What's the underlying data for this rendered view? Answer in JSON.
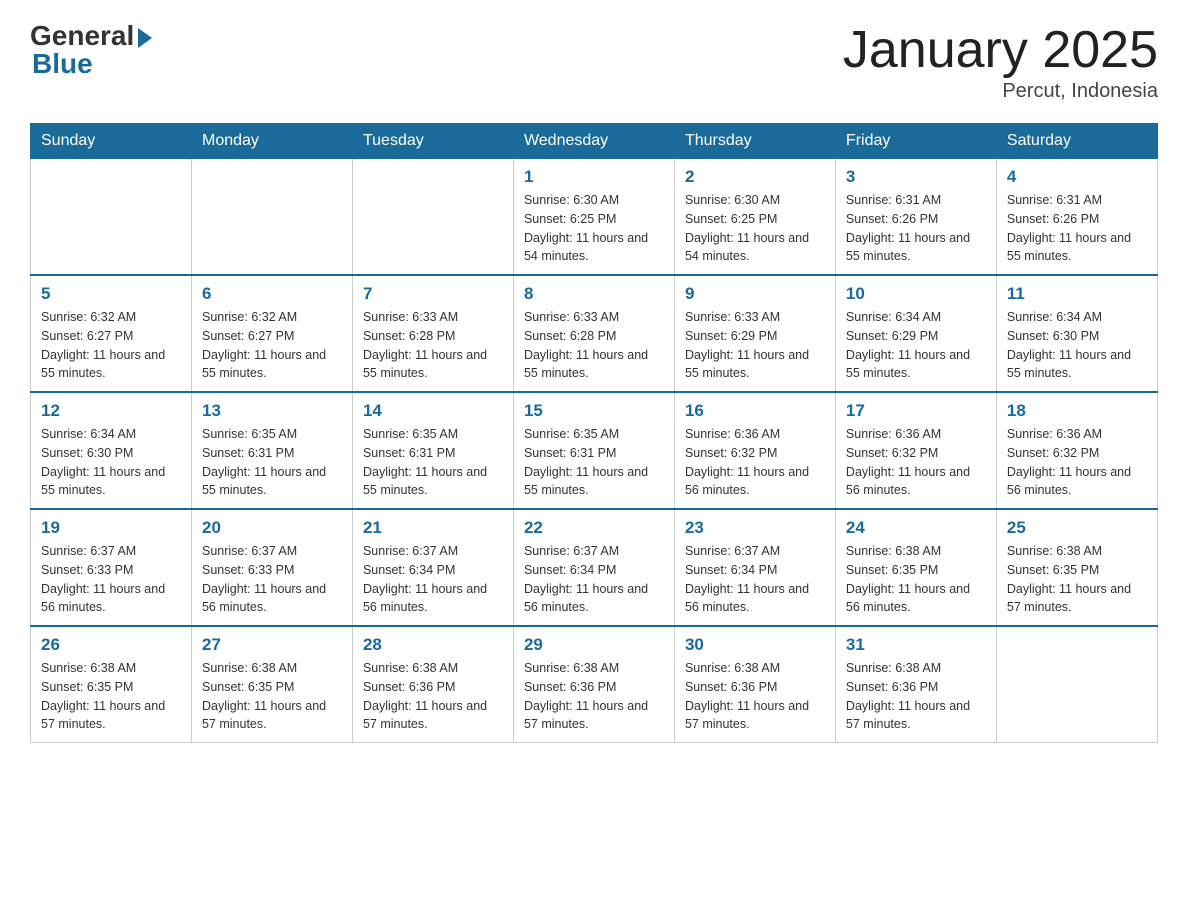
{
  "logo": {
    "general": "General",
    "blue": "Blue"
  },
  "title": "January 2025",
  "subtitle": "Percut, Indonesia",
  "days_of_week": [
    "Sunday",
    "Monday",
    "Tuesday",
    "Wednesday",
    "Thursday",
    "Friday",
    "Saturday"
  ],
  "weeks": [
    [
      {
        "day": "",
        "info": ""
      },
      {
        "day": "",
        "info": ""
      },
      {
        "day": "",
        "info": ""
      },
      {
        "day": "1",
        "info": "Sunrise: 6:30 AM\nSunset: 6:25 PM\nDaylight: 11 hours and 54 minutes."
      },
      {
        "day": "2",
        "info": "Sunrise: 6:30 AM\nSunset: 6:25 PM\nDaylight: 11 hours and 54 minutes."
      },
      {
        "day": "3",
        "info": "Sunrise: 6:31 AM\nSunset: 6:26 PM\nDaylight: 11 hours and 55 minutes."
      },
      {
        "day": "4",
        "info": "Sunrise: 6:31 AM\nSunset: 6:26 PM\nDaylight: 11 hours and 55 minutes."
      }
    ],
    [
      {
        "day": "5",
        "info": "Sunrise: 6:32 AM\nSunset: 6:27 PM\nDaylight: 11 hours and 55 minutes."
      },
      {
        "day": "6",
        "info": "Sunrise: 6:32 AM\nSunset: 6:27 PM\nDaylight: 11 hours and 55 minutes."
      },
      {
        "day": "7",
        "info": "Sunrise: 6:33 AM\nSunset: 6:28 PM\nDaylight: 11 hours and 55 minutes."
      },
      {
        "day": "8",
        "info": "Sunrise: 6:33 AM\nSunset: 6:28 PM\nDaylight: 11 hours and 55 minutes."
      },
      {
        "day": "9",
        "info": "Sunrise: 6:33 AM\nSunset: 6:29 PM\nDaylight: 11 hours and 55 minutes."
      },
      {
        "day": "10",
        "info": "Sunrise: 6:34 AM\nSunset: 6:29 PM\nDaylight: 11 hours and 55 minutes."
      },
      {
        "day": "11",
        "info": "Sunrise: 6:34 AM\nSunset: 6:30 PM\nDaylight: 11 hours and 55 minutes."
      }
    ],
    [
      {
        "day": "12",
        "info": "Sunrise: 6:34 AM\nSunset: 6:30 PM\nDaylight: 11 hours and 55 minutes."
      },
      {
        "day": "13",
        "info": "Sunrise: 6:35 AM\nSunset: 6:31 PM\nDaylight: 11 hours and 55 minutes."
      },
      {
        "day": "14",
        "info": "Sunrise: 6:35 AM\nSunset: 6:31 PM\nDaylight: 11 hours and 55 minutes."
      },
      {
        "day": "15",
        "info": "Sunrise: 6:35 AM\nSunset: 6:31 PM\nDaylight: 11 hours and 55 minutes."
      },
      {
        "day": "16",
        "info": "Sunrise: 6:36 AM\nSunset: 6:32 PM\nDaylight: 11 hours and 56 minutes."
      },
      {
        "day": "17",
        "info": "Sunrise: 6:36 AM\nSunset: 6:32 PM\nDaylight: 11 hours and 56 minutes."
      },
      {
        "day": "18",
        "info": "Sunrise: 6:36 AM\nSunset: 6:32 PM\nDaylight: 11 hours and 56 minutes."
      }
    ],
    [
      {
        "day": "19",
        "info": "Sunrise: 6:37 AM\nSunset: 6:33 PM\nDaylight: 11 hours and 56 minutes."
      },
      {
        "day": "20",
        "info": "Sunrise: 6:37 AM\nSunset: 6:33 PM\nDaylight: 11 hours and 56 minutes."
      },
      {
        "day": "21",
        "info": "Sunrise: 6:37 AM\nSunset: 6:34 PM\nDaylight: 11 hours and 56 minutes."
      },
      {
        "day": "22",
        "info": "Sunrise: 6:37 AM\nSunset: 6:34 PM\nDaylight: 11 hours and 56 minutes."
      },
      {
        "day": "23",
        "info": "Sunrise: 6:37 AM\nSunset: 6:34 PM\nDaylight: 11 hours and 56 minutes."
      },
      {
        "day": "24",
        "info": "Sunrise: 6:38 AM\nSunset: 6:35 PM\nDaylight: 11 hours and 56 minutes."
      },
      {
        "day": "25",
        "info": "Sunrise: 6:38 AM\nSunset: 6:35 PM\nDaylight: 11 hours and 57 minutes."
      }
    ],
    [
      {
        "day": "26",
        "info": "Sunrise: 6:38 AM\nSunset: 6:35 PM\nDaylight: 11 hours and 57 minutes."
      },
      {
        "day": "27",
        "info": "Sunrise: 6:38 AM\nSunset: 6:35 PM\nDaylight: 11 hours and 57 minutes."
      },
      {
        "day": "28",
        "info": "Sunrise: 6:38 AM\nSunset: 6:36 PM\nDaylight: 11 hours and 57 minutes."
      },
      {
        "day": "29",
        "info": "Sunrise: 6:38 AM\nSunset: 6:36 PM\nDaylight: 11 hours and 57 minutes."
      },
      {
        "day": "30",
        "info": "Sunrise: 6:38 AM\nSunset: 6:36 PM\nDaylight: 11 hours and 57 minutes."
      },
      {
        "day": "31",
        "info": "Sunrise: 6:38 AM\nSunset: 6:36 PM\nDaylight: 11 hours and 57 minutes."
      },
      {
        "day": "",
        "info": ""
      }
    ]
  ]
}
